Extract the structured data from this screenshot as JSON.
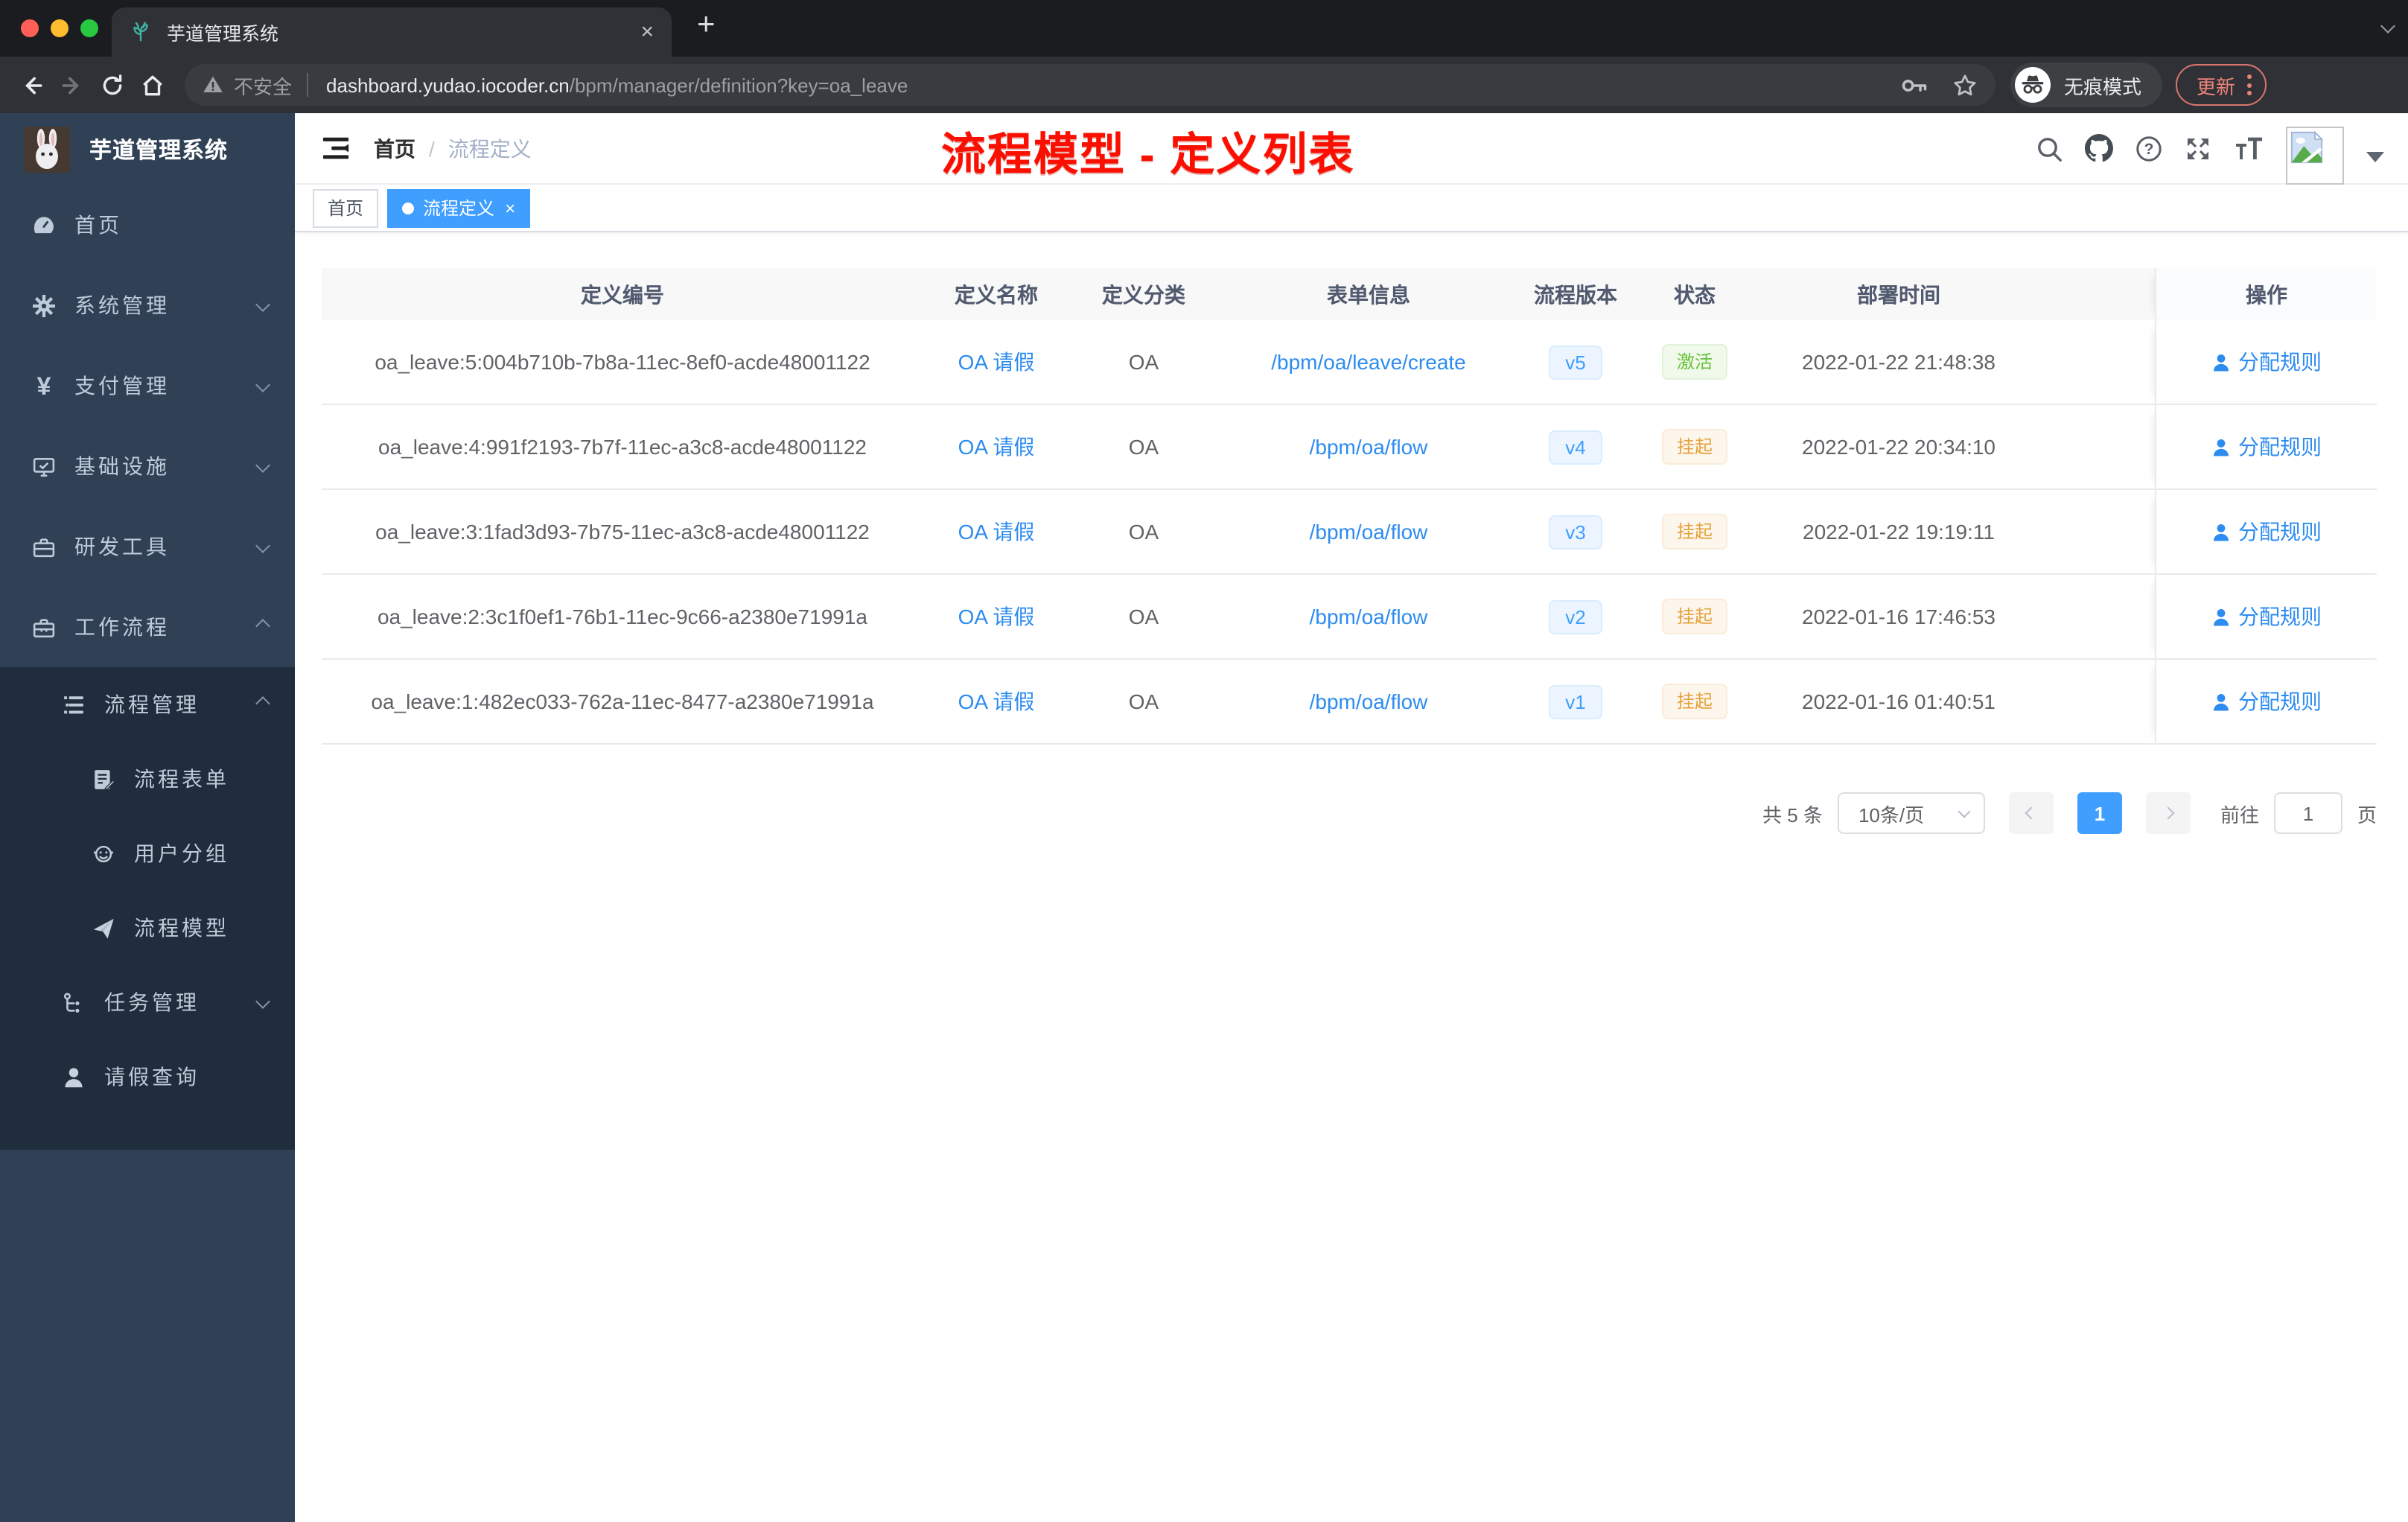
{
  "browser": {
    "tab_title": "芋道管理系统",
    "close_glyph": "×",
    "newtab_glyph": "+",
    "security_label": "不安全",
    "url_domain": "dashboard.yudao.iocoder.cn",
    "url_path": "/bpm/manager/definition?key=oa_leave",
    "incognito_label": "无痕模式",
    "update_label": "更新"
  },
  "glyphs": {
    "yen": "¥",
    "help": "?"
  },
  "sidebar": {
    "logo_title": "芋道管理系统",
    "items": [
      {
        "label": "首页"
      },
      {
        "label": "系统管理"
      },
      {
        "label": "支付管理"
      },
      {
        "label": "基础设施"
      },
      {
        "label": "研发工具"
      },
      {
        "label": "工作流程"
      },
      {
        "label": "流程管理"
      },
      {
        "label": "流程表单"
      },
      {
        "label": "用户分组"
      },
      {
        "label": "流程模型"
      },
      {
        "label": "任务管理"
      },
      {
        "label": "请假查询"
      }
    ]
  },
  "header": {
    "breadcrumb": [
      "首页",
      "流程定义"
    ],
    "separator": "/",
    "annotation": "流程模型 - 定义列表"
  },
  "tags": {
    "home": "首页",
    "active": "流程定义",
    "close_glyph": "×"
  },
  "table": {
    "headers": [
      "定义编号",
      "定义名称",
      "定义分类",
      "表单信息",
      "流程版本",
      "状态",
      "部署时间",
      "操作"
    ],
    "action_label": "分配规则",
    "rows": [
      {
        "id": "oa_leave:5:004b710b-7b8a-11ec-8ef0-acde48001122",
        "name": "OA 请假",
        "category": "OA",
        "form": "/bpm/oa/leave/create",
        "version": "v5",
        "status": "激活",
        "status_type": "success",
        "time": "2022-01-22 21:48:38"
      },
      {
        "id": "oa_leave:4:991f2193-7b7f-11ec-a3c8-acde48001122",
        "name": "OA 请假",
        "category": "OA",
        "form": "/bpm/oa/flow",
        "version": "v4",
        "status": "挂起",
        "status_type": "warning",
        "time": "2022-01-22 20:34:10"
      },
      {
        "id": "oa_leave:3:1fad3d93-7b75-11ec-a3c8-acde48001122",
        "name": "OA 请假",
        "category": "OA",
        "form": "/bpm/oa/flow",
        "version": "v3",
        "status": "挂起",
        "status_type": "warning",
        "time": "2022-01-22 19:19:11"
      },
      {
        "id": "oa_leave:2:3c1f0ef1-76b1-11ec-9c66-a2380e71991a",
        "name": "OA 请假",
        "category": "OA",
        "form": "/bpm/oa/flow",
        "version": "v2",
        "status": "挂起",
        "status_type": "warning",
        "time": "2022-01-16 17:46:53"
      },
      {
        "id": "oa_leave:1:482ec033-762a-11ec-8477-a2380e71991a",
        "name": "OA 请假",
        "category": "OA",
        "form": "/bpm/oa/flow",
        "version": "v1",
        "status": "挂起",
        "status_type": "warning",
        "time": "2022-01-16 01:40:51"
      }
    ]
  },
  "pagination": {
    "total": "共 5 条",
    "page_size": "10条/页",
    "current_page": "1",
    "goto_label": "前往",
    "goto_value": "1",
    "page_unit": "页"
  },
  "colors": {
    "primary": "#409eff",
    "link": "#2d8cf0",
    "sidebar_bg": "#304156",
    "submenu_bg": "#1f2d3d",
    "annotation_red": "#fb0f00",
    "tag_success_text": "#67c23a",
    "tag_warning_text": "#e6a23c"
  }
}
